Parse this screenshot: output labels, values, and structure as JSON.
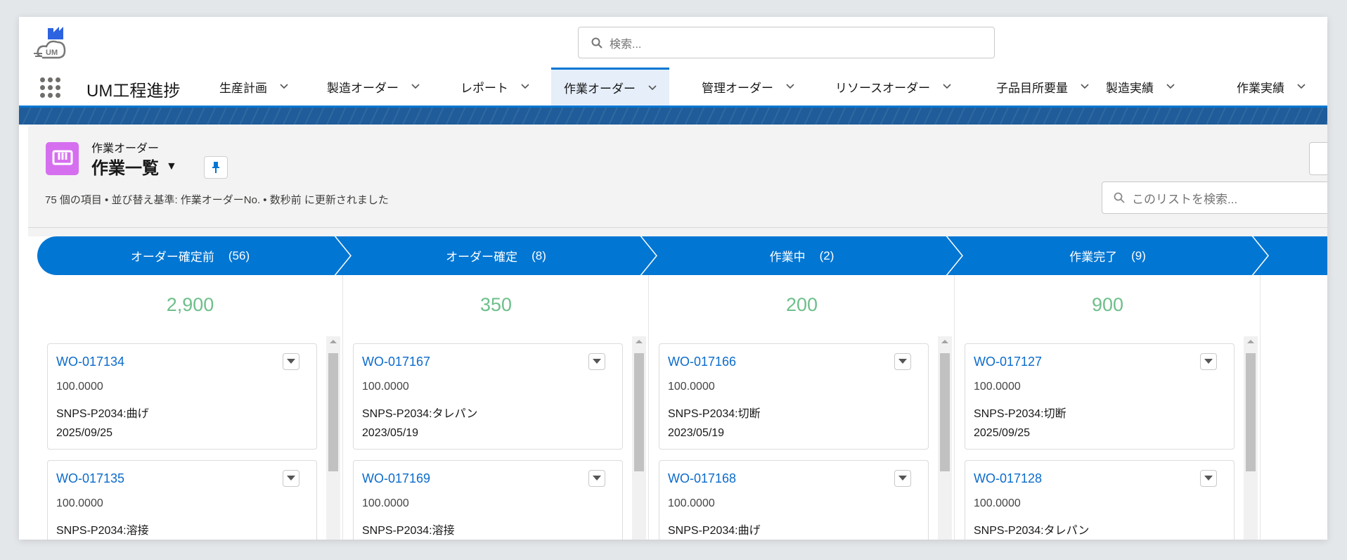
{
  "header": {
    "logo_text": "UM",
    "search_placeholder": "検索...",
    "app_title": "UM工程進捗",
    "nav": [
      {
        "label": "生産計画"
      },
      {
        "label": "製造オーダー"
      },
      {
        "label": "レポート"
      },
      {
        "label": "作業オーダー",
        "active": true
      },
      {
        "label": "管理オーダー"
      },
      {
        "label": "リソースオーダー"
      },
      {
        "label": "子品目所要量"
      },
      {
        "label": "製造実績"
      },
      {
        "label": "作業実績"
      }
    ]
  },
  "list": {
    "object_label": "作業オーダー",
    "view_name": "作業一覧",
    "meta": "75 個の項目 • 並び替え基準: 作業オーダーNo. • 数秒前 に更新されました",
    "search_placeholder": "このリストを検索..."
  },
  "colors": {
    "accent": "#0176d3",
    "total": "#6ebf8b",
    "object_icon": "#d66fef",
    "link": "#0b6bcb"
  },
  "kanban": [
    {
      "stage": "オーダー確定前",
      "count": "(56)",
      "total": "2,900",
      "cards": [
        {
          "id": "WO-017134",
          "qty": "100.0000",
          "name": "SNPS-P2034:曲げ",
          "date": "2025/09/25"
        },
        {
          "id": "WO-017135",
          "qty": "100.0000",
          "name": "SNPS-P2034:溶接"
        }
      ]
    },
    {
      "stage": "オーダー確定",
      "count": "(8)",
      "total": "350",
      "cards": [
        {
          "id": "WO-017167",
          "qty": "100.0000",
          "name": "SNPS-P2034:タレパン",
          "date": "2023/05/19"
        },
        {
          "id": "WO-017169",
          "qty": "100.0000",
          "name": "SNPS-P2034:溶接"
        }
      ]
    },
    {
      "stage": "作業中",
      "count": "(2)",
      "total": "200",
      "cards": [
        {
          "id": "WO-017166",
          "qty": "100.0000",
          "name": "SNPS-P2034:切断",
          "date": "2023/05/19"
        },
        {
          "id": "WO-017168",
          "qty": "100.0000",
          "name": "SNPS-P2034:曲げ"
        }
      ]
    },
    {
      "stage": "作業完了",
      "count": "(9)",
      "total": "900",
      "cards": [
        {
          "id": "WO-017127",
          "qty": "100.0000",
          "name": "SNPS-P2034:切断",
          "date": "2025/09/25"
        },
        {
          "id": "WO-017128",
          "qty": "100.0000",
          "name": "SNPS-P2034:タレパン"
        }
      ]
    }
  ]
}
